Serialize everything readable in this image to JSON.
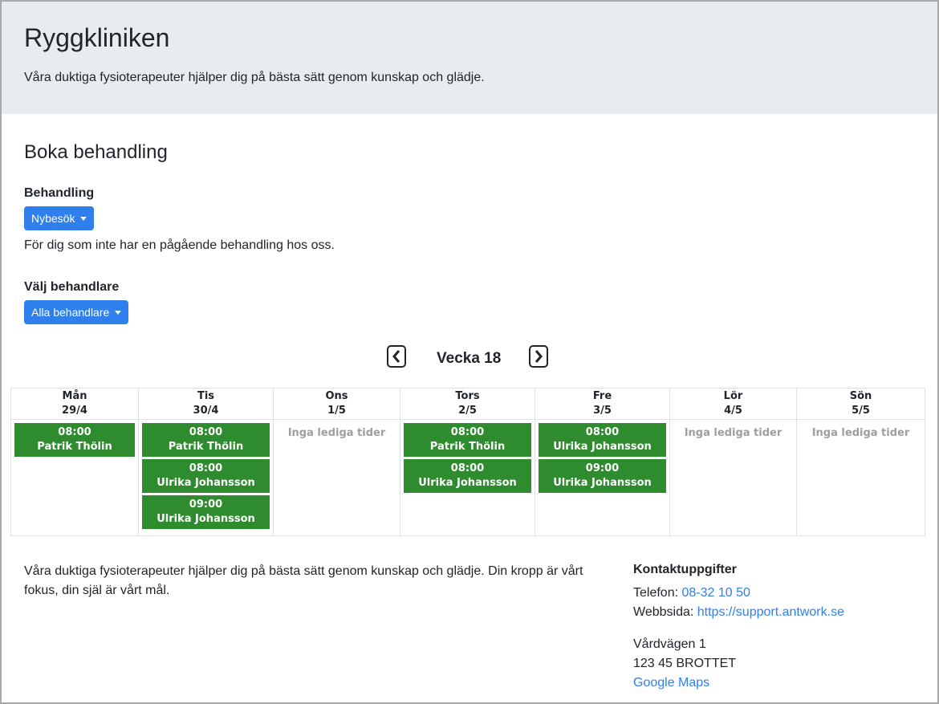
{
  "header": {
    "title": "Ryggkliniken",
    "subtitle": "Våra duktiga fysioterapeuter hjälper dig på bästa sätt genom kunskap och glädje."
  },
  "booking": {
    "heading": "Boka behandling",
    "treatment_label": "Behandling",
    "treatment_selected": "Nybesök",
    "treatment_description": "För dig som inte har en pågående behandling hos oss.",
    "practitioner_label": "Välj behandlare",
    "practitioner_selected": "Alla behandlare"
  },
  "calendar": {
    "week_label": "Vecka 18",
    "no_slots_text": "Inga lediga tider",
    "days": [
      {
        "name": "Mån",
        "date": "29/4",
        "slots": [
          {
            "time": "08:00",
            "who": "Patrik Thölin"
          }
        ]
      },
      {
        "name": "Tis",
        "date": "30/4",
        "slots": [
          {
            "time": "08:00",
            "who": "Patrik Thölin"
          },
          {
            "time": "08:00",
            "who": "Ulrika Johansson"
          },
          {
            "time": "09:00",
            "who": "Ulrika Johansson"
          }
        ]
      },
      {
        "name": "Ons",
        "date": "1/5",
        "slots": []
      },
      {
        "name": "Tors",
        "date": "2/5",
        "slots": [
          {
            "time": "08:00",
            "who": "Patrik Thölin"
          },
          {
            "time": "08:00",
            "who": "Ulrika Johansson"
          }
        ]
      },
      {
        "name": "Fre",
        "date": "3/5",
        "slots": [
          {
            "time": "08:00",
            "who": "Ulrika Johansson"
          },
          {
            "time": "09:00",
            "who": "Ulrika Johansson"
          }
        ]
      },
      {
        "name": "Lör",
        "date": "4/5",
        "slots": []
      },
      {
        "name": "Sön",
        "date": "5/5",
        "slots": []
      }
    ]
  },
  "footer": {
    "about": "Våra duktiga fysioterapeuter hjälper dig på bästa sätt genom kunskap och glädje. Din kropp är vårt fokus, din själ är vårt mål.",
    "contact_heading": "Kontaktuppgifter",
    "phone_label": "Telefon:",
    "phone": "08-32 10 50",
    "web_label": "Webbsida:",
    "web": "https://support.antwork.se",
    "address_line1": "Vårdvägen 1",
    "address_line2": "123 45 BROTTET",
    "maps_link": "Google Maps"
  },
  "colors": {
    "slot_green": "#2e8b2e",
    "primary_blue": "#2f80ed",
    "header_gray": "#e9ecef"
  }
}
